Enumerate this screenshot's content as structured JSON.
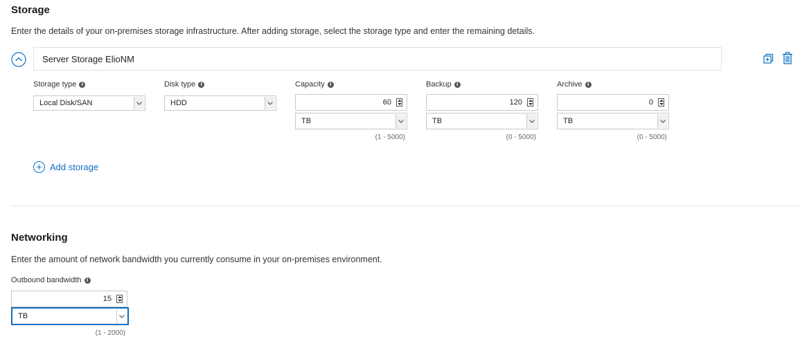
{
  "storage": {
    "title": "Storage",
    "description": "Enter the details of your on-premises storage infrastructure. After adding storage, select the storage type and enter the remaining details.",
    "item": {
      "name": "Server Storage ElioNM",
      "storage_type": {
        "label": "Storage type",
        "value": "Local Disk/SAN"
      },
      "disk_type": {
        "label": "Disk type",
        "value": "HDD"
      },
      "capacity": {
        "label": "Capacity",
        "value": "60",
        "unit": "TB",
        "range": "(1 - 5000)"
      },
      "backup": {
        "label": "Backup",
        "value": "120",
        "unit": "TB",
        "range": "(0 - 5000)"
      },
      "archive": {
        "label": "Archive",
        "value": "0",
        "unit": "TB",
        "range": "(0 - 5000)"
      }
    },
    "add_label": "Add storage"
  },
  "networking": {
    "title": "Networking",
    "description": "Enter the amount of network bandwidth you currently consume in your on-premises environment.",
    "outbound": {
      "label": "Outbound bandwidth",
      "value": "15",
      "unit": "TB",
      "range": "(1 - 2000)"
    }
  },
  "colors": {
    "accent": "#0b6fc2",
    "divider": "#e5e5e5"
  }
}
